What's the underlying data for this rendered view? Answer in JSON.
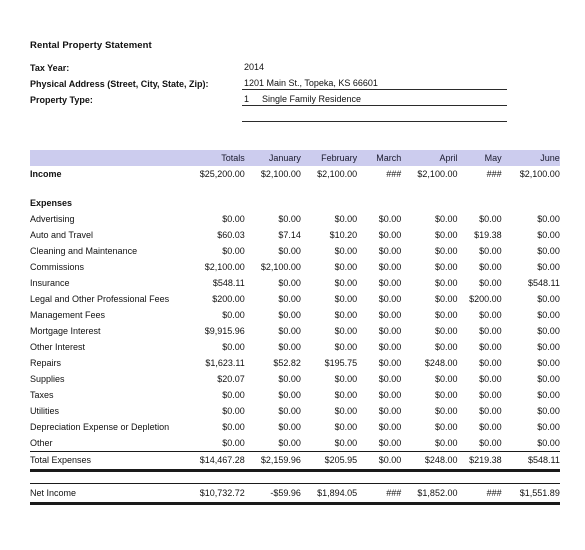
{
  "document": {
    "title": "Rental Property Statement"
  },
  "info": {
    "tax_year": {
      "label": "Tax Year:",
      "value": "2014"
    },
    "address": {
      "label": "Physical Address (Street, City, State, Zip):",
      "value": "1201 Main St., Topeka, KS 66601"
    },
    "property_type": {
      "label": "Property Type:",
      "code": "1",
      "value": "Single Family Residence"
    }
  },
  "table": {
    "headers": [
      "",
      "Totals",
      "January",
      "February",
      "March",
      "April",
      "May",
      "June",
      ""
    ],
    "income": {
      "label": "Income",
      "totals": "$25,200.00",
      "values": [
        "$2,100.00",
        "$2,100.00",
        "###",
        "$2,100.00",
        "###",
        "$2,100.00",
        ""
      ]
    },
    "expenses_heading": "Expenses",
    "expenses": [
      {
        "label": "Advertising",
        "totals": "$0.00",
        "values": [
          "$0.00",
          "$0.00",
          "$0.00",
          "$0.00",
          "$0.00",
          "$0.00",
          ""
        ]
      },
      {
        "label": "Auto and Travel",
        "totals": "$60.03",
        "values": [
          "$7.14",
          "$10.20",
          "$0.00",
          "$0.00",
          "$19.38",
          "$0.00",
          ""
        ]
      },
      {
        "label": "Cleaning and Maintenance",
        "totals": "$0.00",
        "values": [
          "$0.00",
          "$0.00",
          "$0.00",
          "$0.00",
          "$0.00",
          "$0.00",
          ""
        ]
      },
      {
        "label": "Commissions",
        "totals": "$2,100.00",
        "values": [
          "$2,100.00",
          "$0.00",
          "$0.00",
          "$0.00",
          "$0.00",
          "$0.00",
          ""
        ]
      },
      {
        "label": "Insurance",
        "totals": "$548.11",
        "values": [
          "$0.00",
          "$0.00",
          "$0.00",
          "$0.00",
          "$0.00",
          "$548.11",
          ""
        ]
      },
      {
        "label": "Legal and Other Professional Fees",
        "totals": "$200.00",
        "values": [
          "$0.00",
          "$0.00",
          "$0.00",
          "$0.00",
          "$200.00",
          "$0.00",
          ""
        ]
      },
      {
        "label": "Management Fees",
        "totals": "$0.00",
        "values": [
          "$0.00",
          "$0.00",
          "$0.00",
          "$0.00",
          "$0.00",
          "$0.00",
          ""
        ]
      },
      {
        "label": "Mortgage Interest",
        "totals": "$9,915.96",
        "values": [
          "$0.00",
          "$0.00",
          "$0.00",
          "$0.00",
          "$0.00",
          "$0.00",
          ""
        ]
      },
      {
        "label": "Other Interest",
        "totals": "$0.00",
        "values": [
          "$0.00",
          "$0.00",
          "$0.00",
          "$0.00",
          "$0.00",
          "$0.00",
          ""
        ]
      },
      {
        "label": "Repairs",
        "totals": "$1,623.11",
        "values": [
          "$52.82",
          "$195.75",
          "$0.00",
          "$248.00",
          "$0.00",
          "$0.00",
          "$"
        ]
      },
      {
        "label": "Supplies",
        "totals": "$20.07",
        "values": [
          "$0.00",
          "$0.00",
          "$0.00",
          "$0.00",
          "$0.00",
          "$0.00",
          ""
        ]
      },
      {
        "label": "Taxes",
        "totals": "$0.00",
        "values": [
          "$0.00",
          "$0.00",
          "$0.00",
          "$0.00",
          "$0.00",
          "$0.00",
          ""
        ]
      },
      {
        "label": "Utilities",
        "totals": "$0.00",
        "values": [
          "$0.00",
          "$0.00",
          "$0.00",
          "$0.00",
          "$0.00",
          "$0.00",
          ""
        ]
      },
      {
        "label": "Depreciation Expense or Depletion",
        "totals": "$0.00",
        "values": [
          "$0.00",
          "$0.00",
          "$0.00",
          "$0.00",
          "$0.00",
          "$0.00",
          ""
        ]
      },
      {
        "label": "Other",
        "totals": "$0.00",
        "values": [
          "$0.00",
          "$0.00",
          "$0.00",
          "$0.00",
          "$0.00",
          "$0.00",
          ""
        ]
      }
    ],
    "total_expenses": {
      "label": "Total Expenses",
      "totals": "$14,467.28",
      "values": [
        "$2,159.96",
        "$205.95",
        "$0.00",
        "$248.00",
        "$219.38",
        "$548.11",
        "$"
      ]
    },
    "net_income": {
      "label": "Net Income",
      "totals": "$10,732.72",
      "values": [
        "-$59.96",
        "$1,894.05",
        "###",
        "$1,852.00",
        "###",
        "$1,551.89",
        ""
      ]
    }
  },
  "colors": {
    "header_band": "#ccccee",
    "rule": "#1a1a1a",
    "background": "#ffffff"
  }
}
